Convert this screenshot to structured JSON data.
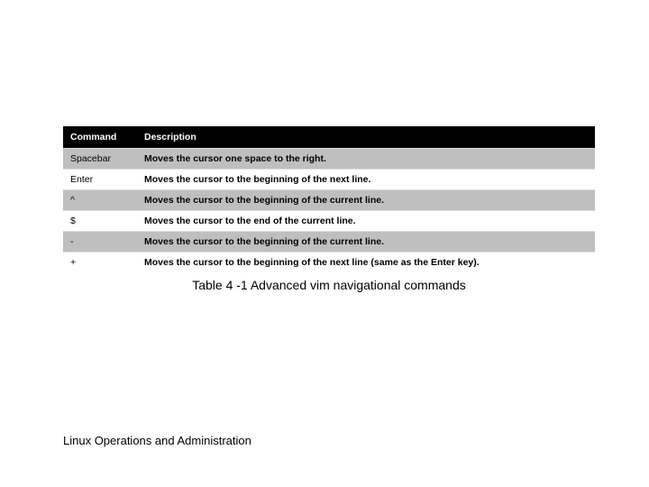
{
  "table": {
    "headers": [
      "Command",
      "Description"
    ],
    "rows": [
      {
        "command": "Spacebar",
        "description": "Moves the cursor one space to the right."
      },
      {
        "command": "Enter",
        "description": "Moves the cursor to the beginning of the next line."
      },
      {
        "command": "^",
        "description": "Moves the cursor to the beginning of the current line."
      },
      {
        "command": "$",
        "description": "Moves the cursor to the end of the current line."
      },
      {
        "command": "-",
        "description": "Moves the cursor to the beginning of the current line."
      },
      {
        "command": "+",
        "description": "Moves the cursor to the beginning of the next line (same as the Enter key)."
      }
    ]
  },
  "caption": "Table 4 -1 Advanced vim navigational commands",
  "footer": "Linux Operations and Administration"
}
